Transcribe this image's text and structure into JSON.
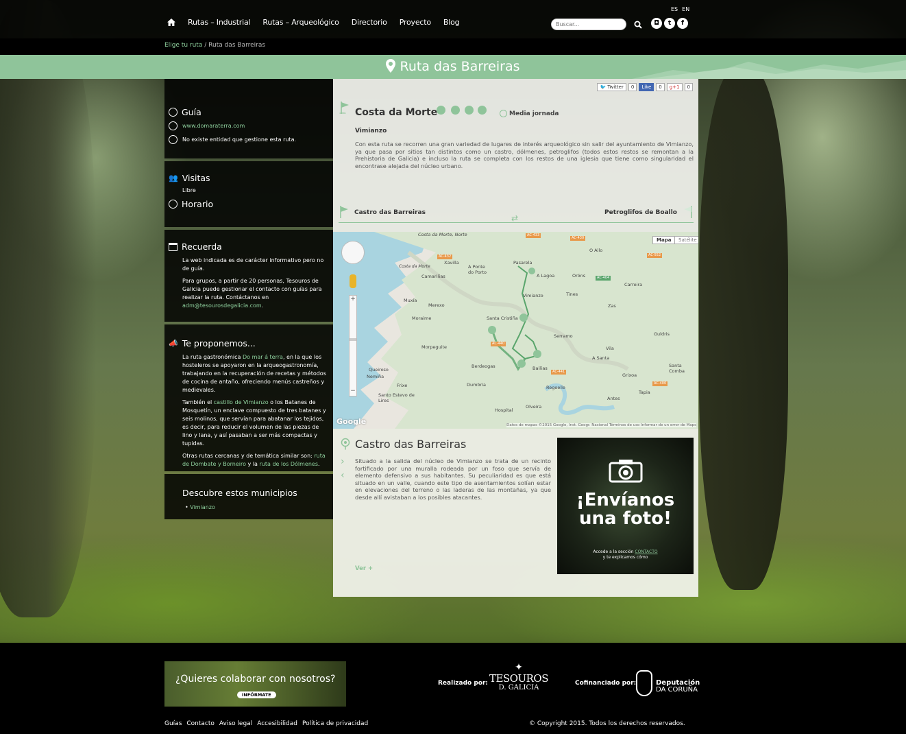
{
  "nav": {
    "items": [
      "Rutas – Industrial",
      "Rutas – Arqueológico",
      "Directorio",
      "Proyecto",
      "Blog"
    ],
    "lang": [
      "ES",
      "EN"
    ],
    "search_placeholder": "Buscar...",
    "social_icons": [
      "instagram-icon",
      "twitter-icon",
      "facebook-icon"
    ]
  },
  "breadcrumb": {
    "link": "Elige tu ruta",
    "sep": "/",
    "current": "Ruta das Barreiras"
  },
  "page_title": "Ruta das Barreiras",
  "sidebar": {
    "guia": {
      "title": "Guía",
      "web": "www.domaraterra.com",
      "note": "No existe entidad que gestione esta ruta."
    },
    "visitas": {
      "title": "Visitas",
      "value": "Libre",
      "horario": "Horario"
    },
    "recuerda": {
      "title": "Recuerda",
      "p1": "La web indicada es de carácter informativo pero no de guía.",
      "p2": "Para grupos, a partir de 20 personas, Tesouros de Galicia puede gestionar el contacto con guías para realizar la ruta. Contáctanos en",
      "email": "adm@tesourosdegalicia.com",
      "p2_end": "."
    },
    "proponemos": {
      "title": "Te proponemos...",
      "p1a": "La ruta gastronómica ",
      "p1link": "Do mar á terra",
      "p1b": ", en la que los hosteleros se apoyaron en la arqueogastronomía, trabajando en la recuperación de recetas y métodos de cocina de antaño, ofreciendo menús castreños y medievales.",
      "p2a": "También el ",
      "p2link": "castillo de Vimianzo",
      "p2b": " o los Batanes de Mosquetín, un enclave compuesto de tres batanes y seis molinos, que servían para abatanar los tejidos, es decir, para reducir el volumen de las piezas de lino y lana, y así pasaban a ser más compactas y tupidas.",
      "p3a": "Otras rutas cercanas y de temática similar son: ",
      "p3link1": "ruta de Dombate y Borneiro",
      "p3b": " y la ",
      "p3link2": "ruta de los Dólmenes",
      "p3c": "."
    },
    "municipios": {
      "title": "Descubre estos municipios",
      "items": [
        "Vimianzo"
      ]
    }
  },
  "main": {
    "share": {
      "twitter": "Twitter",
      "tw_count": "0",
      "like": "Like",
      "like_count": "0",
      "gplus": "g+1",
      "gplus_count": "0"
    },
    "route_zone": "Costa da Morte",
    "duration": "Media jornada",
    "municipality": "Vimianzo",
    "description": "Con esta ruta se recorren una gran variedad de lugares de interés arqueológico sin salir del ayuntamiento de Vimianzo, ya que pasa por sitios tan distintos como un castro, dólmenes, petroglifos (todos estos restos se remontan a la Prehistoria de Galicia) e incluso la ruta se completa con los restos de una iglesia que tiene como singularidad el encontrase alejada del núcleo urbano.",
    "prev_stop": "Castro das Barreiras",
    "next_stop": "Petroglifos de Boallo",
    "map": {
      "btn_map": "Mapa",
      "btn_sat": "Satélite",
      "places": [
        "Costa da Morte, Norte",
        "Xavilla",
        "A Ponte do Porto",
        "Pasarela",
        "O Allo",
        "Costa da Morte",
        "Camariñas",
        "A Lagoa",
        "Oróns",
        "Carreira",
        "Muxía",
        "Vimianzo",
        "Tines",
        "Merexo",
        "Zas",
        "Moraime",
        "Santa Cristiña",
        "Serramo",
        "Guldris",
        "Morpeguite",
        "Vila",
        "A Santa",
        "Berdeogas",
        "Baíñas",
        "Grixoa",
        "Santa Comba",
        "Queiroso",
        "Nemiña",
        "Frixe",
        "Dumbria",
        "Regoelle",
        "Tapia",
        "Santo Estevo de Lires",
        "Antes",
        "Hospital",
        "Olveira"
      ],
      "roads": [
        "AC-433",
        "AC-430",
        "AC-432",
        "AC-552",
        "AC-404",
        "AC-441",
        "AC-440",
        "AC-400"
      ],
      "attribution": "Datos de mapas ©2015 Google, Inst. Geogr. Nacional   Términos de uso   Informar de un error de Maps",
      "logo": "Google"
    },
    "poi": {
      "name": "Castro das Barreiras",
      "text": "Situado a la salida del núcleo de Vimianzo se trata de un recinto fortificado por una muralla rodeada por un foso que servía de elemento defensivo a sus habitantes. Su peculiaridad es que está situado en un valle, cuando este tipo de asentamientos solían estar en elevaciones del terreno o las laderas de las montañas, ya que desde allí avistaban a los posibles atacantes.",
      "more": "Ver +"
    },
    "promo": {
      "title1": "¡Envíanos",
      "title2": "una foto!",
      "sub1": "Accede a la sección ",
      "sub_link": "CONTACTO",
      "sub2": "y te explicamos cómo"
    }
  },
  "footer": {
    "collab": "¿Quieres colaborar con nosotros?",
    "collab_btn": "INFÓRMATE",
    "realizado": "Realizado por:",
    "tesouros_1": "TESOUROS",
    "tesouros_2": "D. GALICIA",
    "cofinanciado": "Cofinanciado por:",
    "dep_1": "Deputación",
    "dep_2": "DA CORUÑA",
    "links": [
      "Guías",
      "Contacto",
      "Aviso legal",
      "Accesibilidad",
      "Política de privacidad"
    ],
    "copyright": "© Copyright 2015. Todos los derechos reservados."
  },
  "colors": {
    "accent": "#8fc49a",
    "link": "#8fd19e"
  }
}
